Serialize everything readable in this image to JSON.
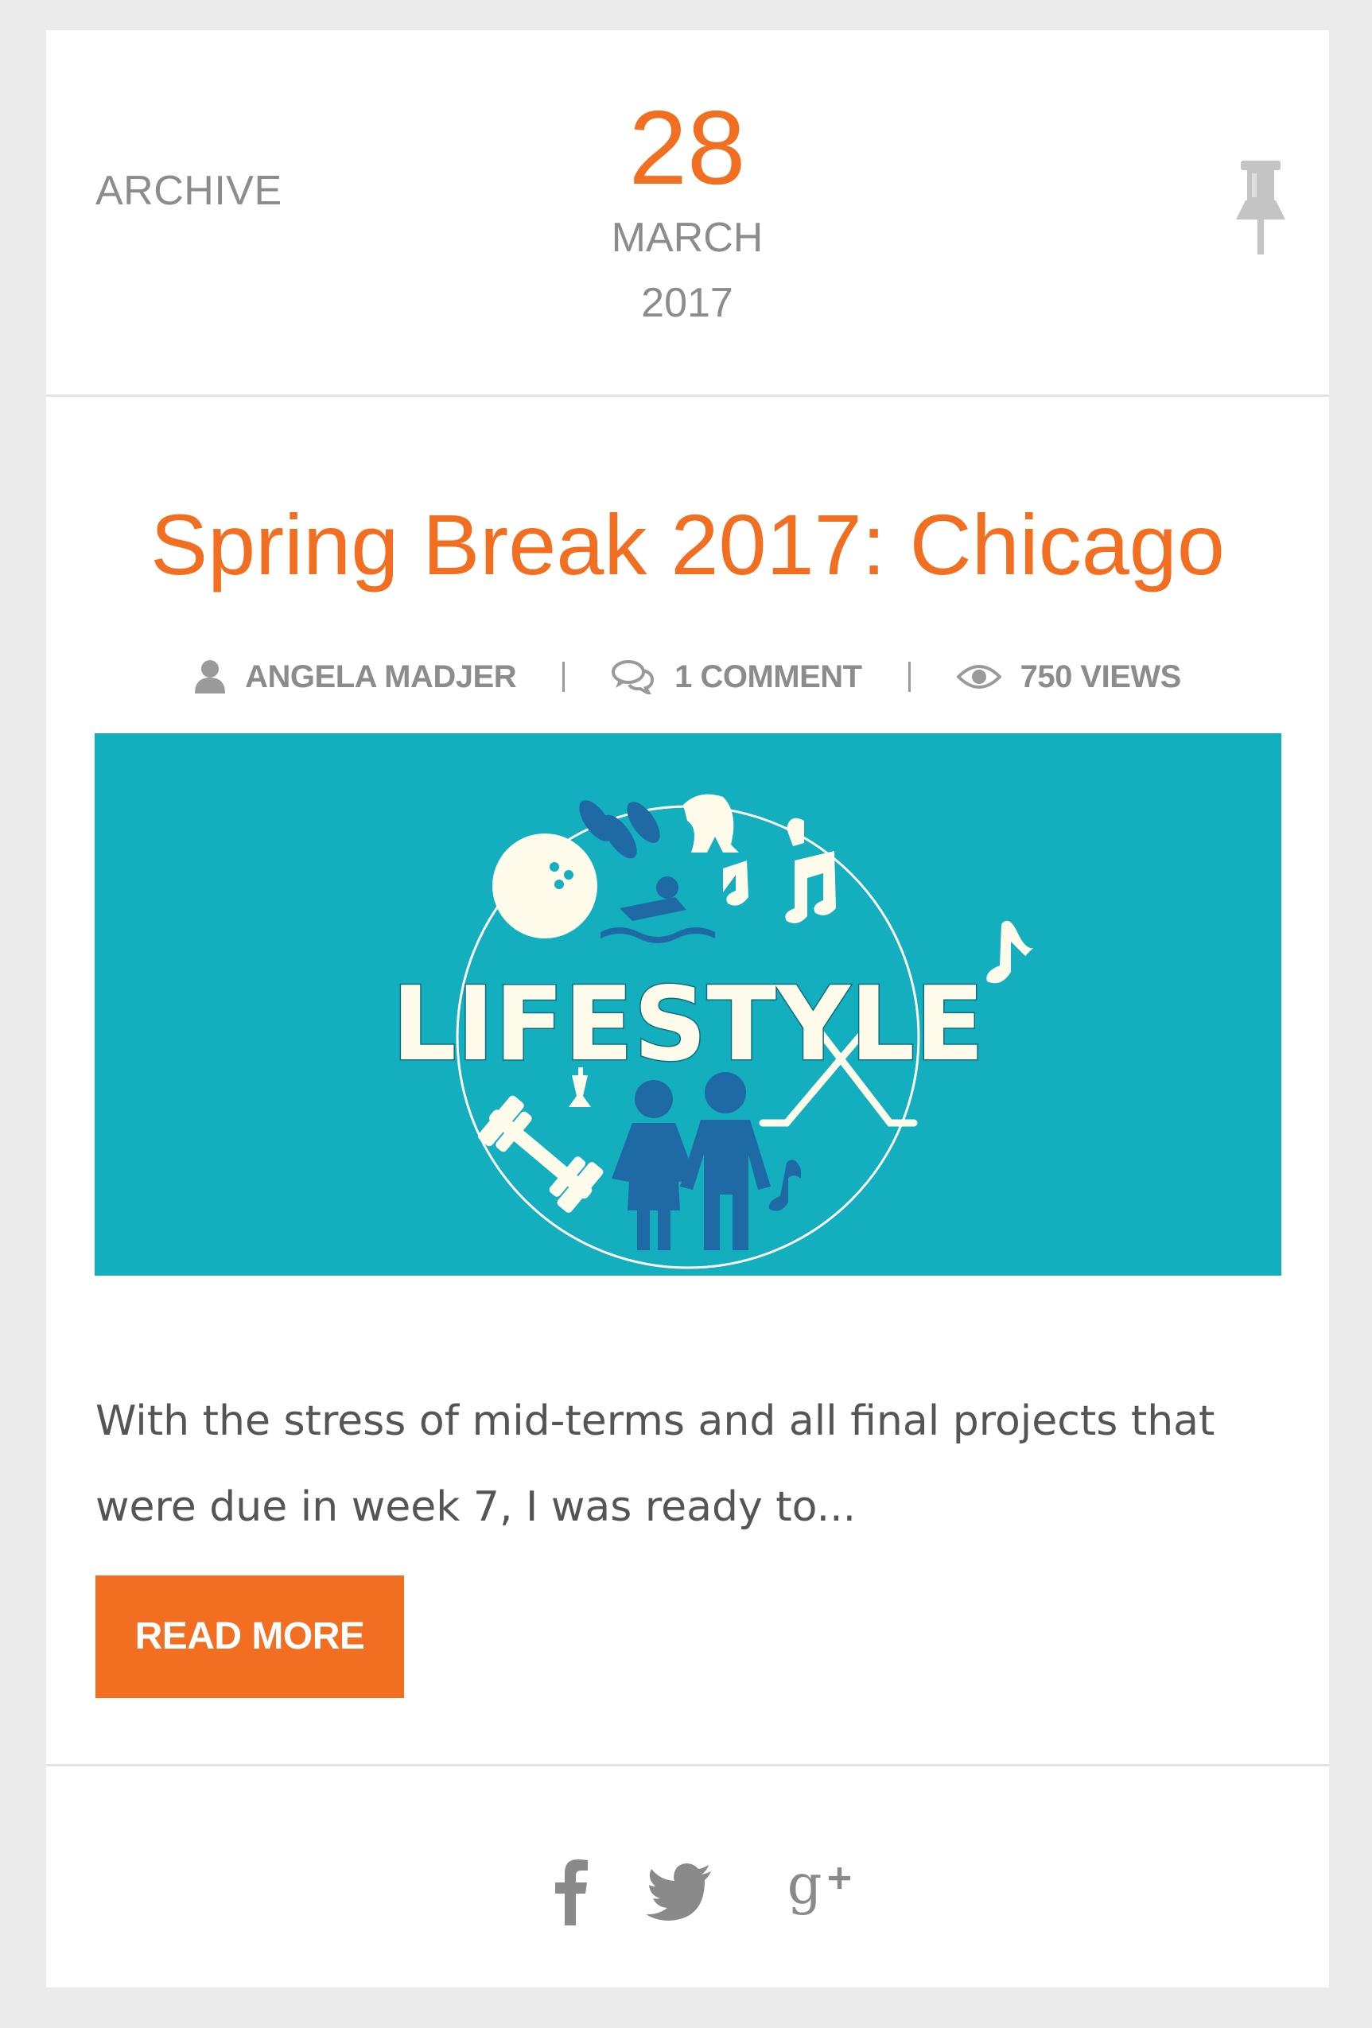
{
  "header": {
    "archive_label": "ARCHIVE",
    "date": {
      "day": "28",
      "month": "MARCH",
      "year": "2017"
    },
    "pin_icon": "pushpin-icon"
  },
  "post": {
    "title": "Spring Break 2017: Chicago",
    "meta": {
      "author": "ANGELA MADJER",
      "comments": "1 COMMENT",
      "views": "750 VIEWS"
    },
    "image": {
      "banner_text": "LIFESTYLE",
      "background_color": "#13afbe"
    },
    "excerpt": "With the stress of mid-terms and all final projects that were due in week 7, I was ready to...",
    "read_more_label": "READ MORE"
  },
  "footer": {
    "social_icons": [
      "facebook-icon",
      "twitter-icon",
      "google-plus-icon"
    ]
  },
  "colors": {
    "accent": "#f26f21",
    "muted_text": "#8c8c8c",
    "page_background": "#ecebeb"
  }
}
